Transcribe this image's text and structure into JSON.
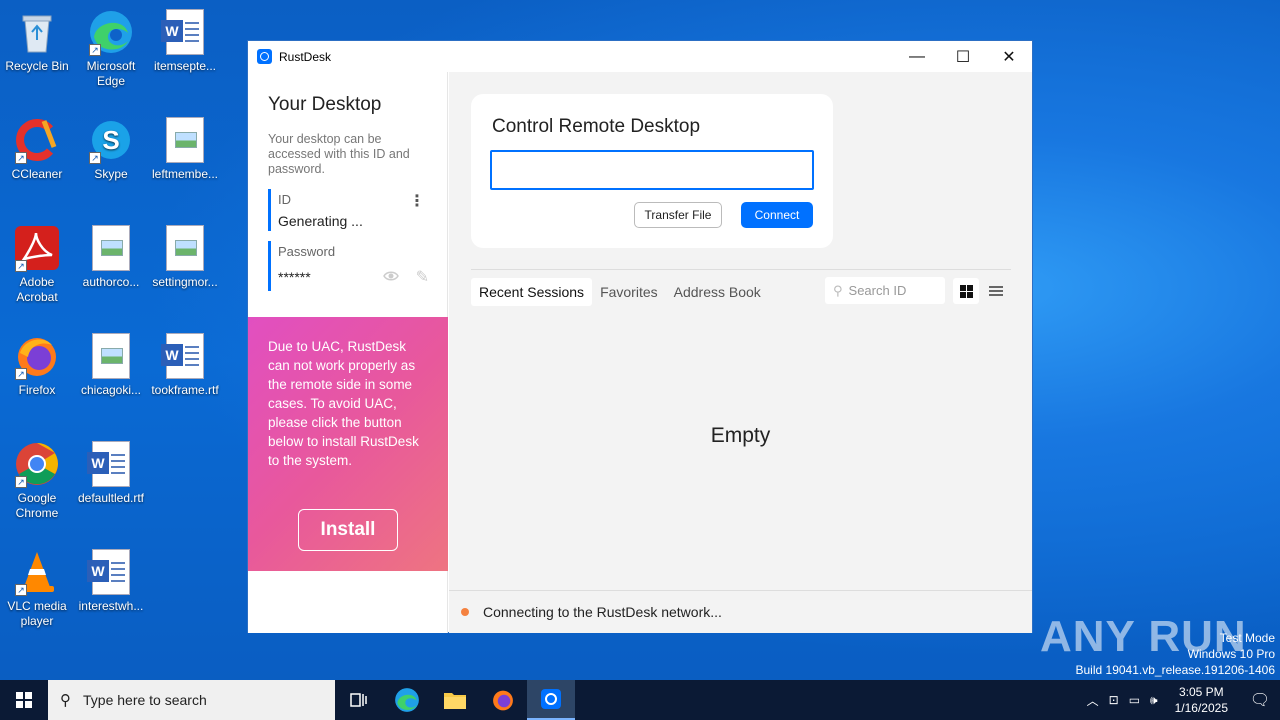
{
  "desktop": {
    "icons": [
      {
        "label": "Recycle Bin"
      },
      {
        "label": "Microsoft Edge"
      },
      {
        "label": "itemsepte..."
      },
      {
        "label": "CCleaner"
      },
      {
        "label": "Skype"
      },
      {
        "label": "leftmembe..."
      },
      {
        "label": "Adobe Acrobat"
      },
      {
        "label": "authorco..."
      },
      {
        "label": "settingmor..."
      },
      {
        "label": "Firefox"
      },
      {
        "label": "chicagoki..."
      },
      {
        "label": "tookframe.rtf"
      },
      {
        "label": "Google Chrome"
      },
      {
        "label": "defaultled.rtf"
      },
      {
        "label": "VLC media player"
      },
      {
        "label": "interestwh..."
      }
    ]
  },
  "window": {
    "title": "RustDesk",
    "controls": {
      "minimize": "—",
      "maximize": "☐",
      "close": "✕"
    }
  },
  "left": {
    "heading": "Your Desktop",
    "description": "Your desktop can be accessed with this ID and password.",
    "id_label": "ID",
    "id_value": "Generating ...",
    "password_label": "Password",
    "password_value": "******",
    "uac_text": "Due to UAC, RustDesk can not work properly as the remote side in some cases. To avoid UAC, please click the button below to install RustDesk to the system.",
    "install_label": "Install"
  },
  "right": {
    "card_title": "Control Remote Desktop",
    "remote_id_value": "",
    "transfer_label": "Transfer File",
    "connect_label": "Connect",
    "tabs": [
      {
        "label": "Recent Sessions"
      },
      {
        "label": "Favorites"
      },
      {
        "label": "Address Book"
      }
    ],
    "search_placeholder": "Search ID",
    "empty_text": "Empty",
    "status_text": "Connecting to the RustDesk network...",
    "status_color": "#f4813f"
  },
  "watermark": {
    "brand": "ANY RUN",
    "line1": "Test Mode",
    "line2": "Windows 10 Pro",
    "line3": "Build 19041.vb_release.191206-1406"
  },
  "taskbar": {
    "search_placeholder": "Type here to search",
    "time": "3:05 PM",
    "date": "1/16/2025"
  },
  "colors": {
    "accent": "#0071ff",
    "uac_gradient_start": "#e14fc1",
    "uac_gradient_end": "#ee7481"
  }
}
